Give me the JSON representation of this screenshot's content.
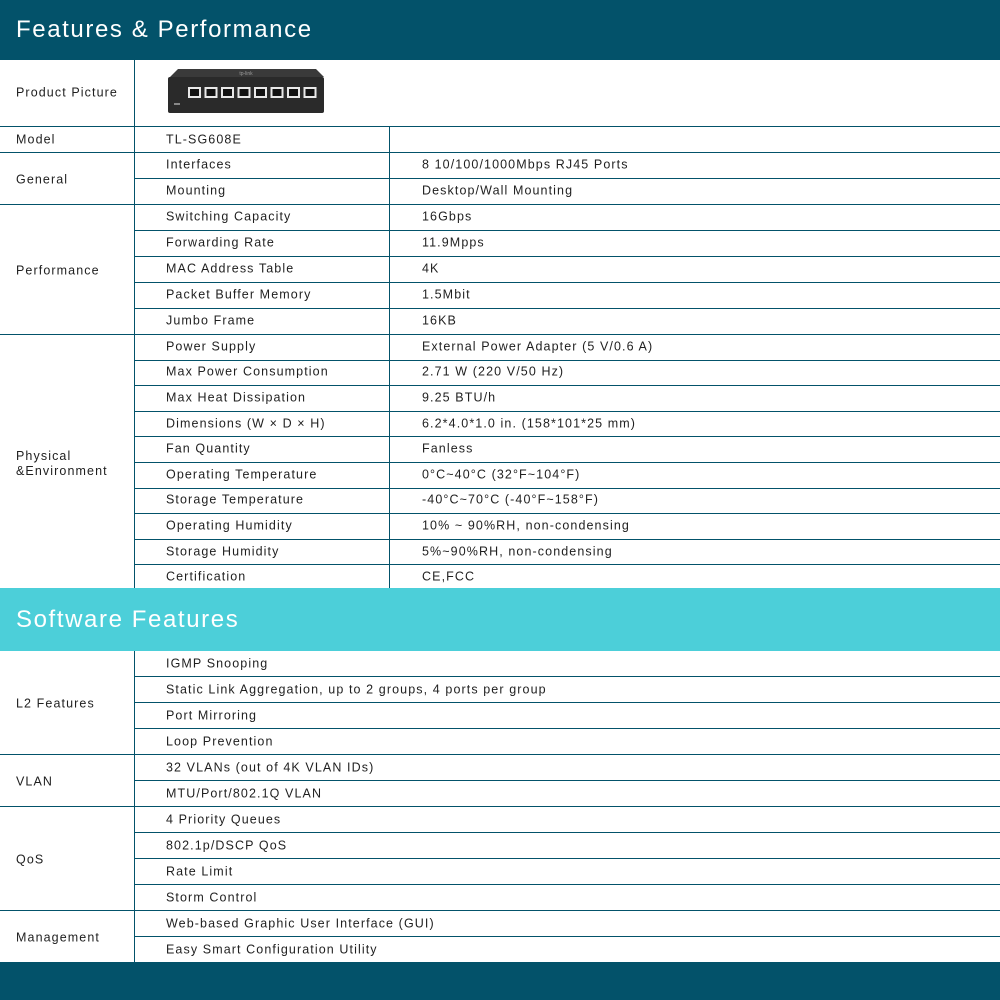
{
  "headers": {
    "features_performance": "Features & Performance",
    "software_features": "Software Features"
  },
  "product_picture": {
    "label": "Product Picture",
    "device_brand_text": "tp-link",
    "port_count": 8
  },
  "model": {
    "label": "Model",
    "value": "TL-SG608E"
  },
  "hardware_groups": [
    {
      "category": "General",
      "rows": [
        {
          "feature": "Interfaces",
          "value": "8 10/100/1000Mbps RJ45 Ports"
        },
        {
          "feature": "Mounting",
          "value": "Desktop/Wall Mounting"
        }
      ]
    },
    {
      "category": "Performance",
      "rows": [
        {
          "feature": "Switching Capacity",
          "value": "16Gbps"
        },
        {
          "feature": "Forwarding Rate",
          "value": "11.9Mpps"
        },
        {
          "feature": "MAC Address Table",
          "value": "4K"
        },
        {
          "feature": "Packet Buffer Memory",
          "value": "1.5Mbit"
        },
        {
          "feature": "Jumbo Frame",
          "value": "16KB"
        }
      ]
    },
    {
      "category": "Physical\n&Environment",
      "rows": [
        {
          "feature": "Power Supply",
          "value": "External Power Adapter (5 V/0.6 A)"
        },
        {
          "feature": "Max Power Consumption",
          "value": "2.71 W (220 V/50 Hz)"
        },
        {
          "feature": "Max Heat Dissipation",
          "value": "9.25 BTU/h"
        },
        {
          "feature": "Dimensions (W × D × H)",
          "value": "6.2*4.0*1.0 in. (158*101*25 mm)"
        },
        {
          "feature": "Fan Quantity",
          "value": "Fanless"
        },
        {
          "feature": "Operating Temperature",
          "value": "0°C~40°C (32°F~104°F)"
        },
        {
          "feature": "Storage Temperature",
          "value": "-40°C~70°C (-40°F~158°F)"
        },
        {
          "feature": "Operating Humidity",
          "value": "10% ~ 90%RH, non-condensing"
        },
        {
          "feature": "Storage Humidity",
          "value": "5%~90%RH, non-condensing"
        },
        {
          "feature": "Certification",
          "value": "CE,FCC"
        }
      ]
    }
  ],
  "software_groups": [
    {
      "category": "L2 Features",
      "rows": [
        "IGMP Snooping",
        "Static Link Aggregation, up to 2 groups, 4 ports per group",
        "Port Mirroring",
        "Loop Prevention"
      ]
    },
    {
      "category": "VLAN",
      "rows": [
        "32 VLANs (out of 4K VLAN IDs)",
        "MTU/Port/802.1Q VLAN"
      ]
    },
    {
      "category": "QoS",
      "rows": [
        "4 Priority Queues",
        "802.1p/DSCP QoS",
        "Rate Limit",
        "Storm Control"
      ]
    },
    {
      "category": "Management",
      "rows": [
        "Web-based Graphic User Interface (GUI)",
        "Easy Smart Configuration Utility"
      ]
    }
  ]
}
